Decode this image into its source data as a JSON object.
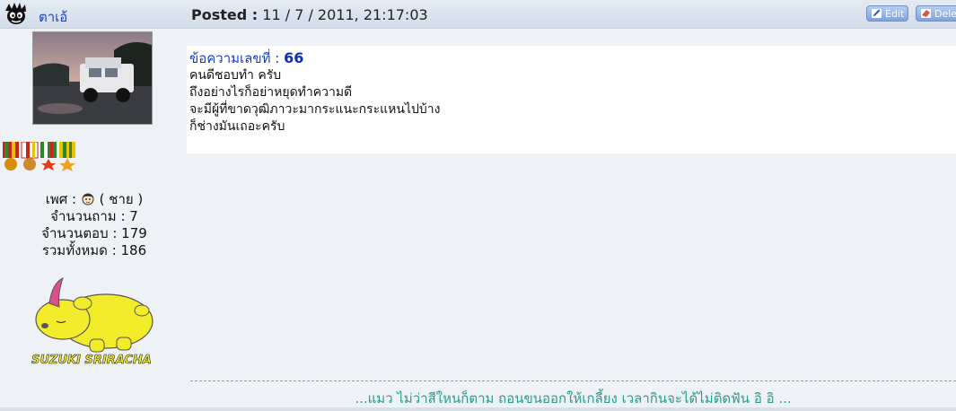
{
  "header": {
    "author_name": "ตาเอ้",
    "posted_label": "Posted :",
    "posted_date": "11 / 7 / 2011, 21:17:03",
    "edit_label": "Edit",
    "delete_label": "Delete"
  },
  "profile": {
    "gender_label": "เพศ :",
    "gender_value": "( ชาย )",
    "questions": "จำนวนถาม : 7",
    "answers": "จำนวนตอบ : 179",
    "total": "รวมทั้งหมด : 186",
    "signature_logo_text": "SUZUKI SRIRACHA"
  },
  "message": {
    "number_label": "ข้อความเลขที่ :",
    "number": "66",
    "lines": [
      "คนดีชอบทำ ครับ",
      "ถึงอย่างไรก็อย่าหยุดทำความดี",
      "จะมีผู้ที่ขาดวุฒิภาวะมากระแนะกระแหนไปบ้าง",
      "ก็ช่างมันเถอะครับ"
    ]
  },
  "signature": {
    "text": "...แมว ไม่ว่าสีใหนก็ตาม ถอนขนออกให้เกลี้ยง เวลากินจะได้ไม่ติดฟัน อิ อิ ..."
  },
  "icons": {
    "author": "bad-badtz-maru-icon",
    "edit": "pencil-icon",
    "delete": "eraser-icon",
    "gender": "boy-face-icon"
  }
}
